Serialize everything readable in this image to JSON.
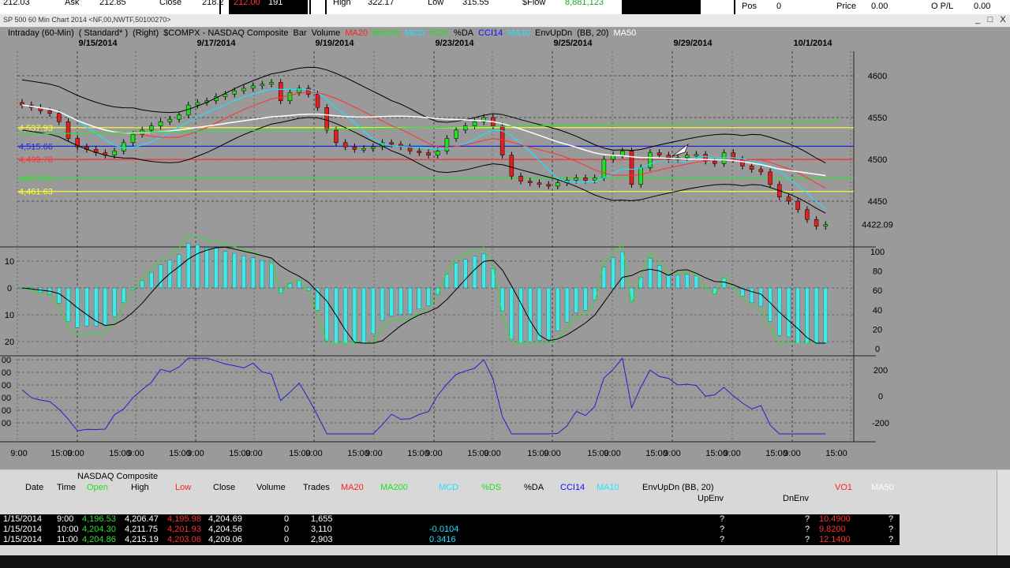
{
  "ticker": {
    "items": [
      {
        "label": "212.03",
        "color": "#000"
      },
      {
        "label": "Ask",
        "color": "#000"
      },
      {
        "label": "212.85",
        "color": "#000"
      },
      {
        "label": "Close",
        "color": "#000"
      },
      {
        "label": "218.2",
        "color": "#000"
      },
      {
        "label": "212.00",
        "color": "#ff2020"
      },
      {
        "label": "191",
        "color": "#fff"
      },
      {
        "label": "High",
        "color": "#000"
      },
      {
        "label": "322.17",
        "color": "#000"
      },
      {
        "label": "Low",
        "color": "#000"
      },
      {
        "label": "315.55",
        "color": "#000"
      },
      {
        "label": "$Flow",
        "color": "#000"
      },
      {
        "label": "8,881,123",
        "color": "#20a020"
      },
      {
        "label": "Pos",
        "color": "#000"
      },
      {
        "label": "0",
        "color": "#000"
      },
      {
        "label": "Price",
        "color": "#000"
      },
      {
        "label": "0.00",
        "color": "#000"
      },
      {
        "label": "O P/L",
        "color": "#000"
      },
      {
        "label": "0.00",
        "color": "#000"
      }
    ]
  },
  "window": {
    "title": "SP 500 60 Min Chart 2014 <NF,00,NWTF,50100270>",
    "minimize": "_",
    "maximize": "□",
    "close": "X"
  },
  "chart_header": [
    {
      "text": "Intraday (60-Min)",
      "color": "#000"
    },
    {
      "text": "( Standard* )",
      "color": "#000"
    },
    {
      "text": "(Right)",
      "color": "#000"
    },
    {
      "text": "$COMPX - NASDAQ Composite",
      "color": "#000"
    },
    {
      "text": "Bar",
      "color": "#000"
    },
    {
      "text": "Volume",
      "color": "#000"
    },
    {
      "text": "MA20",
      "color": "#ff2020"
    },
    {
      "text": "MA200",
      "color": "#20e020"
    },
    {
      "text": "MCD",
      "color": "#20e0ff"
    },
    {
      "text": "%DS",
      "color": "#20e020"
    },
    {
      "text": "%DA",
      "color": "#000"
    },
    {
      "text": "CCI14",
      "color": "#1010ff"
    },
    {
      "text": "MA10",
      "color": "#20e0ff"
    },
    {
      "text": "EnvUpDn",
      "color": "#000"
    },
    {
      "text": "(BB, 20)",
      "color": "#000"
    },
    {
      "text": "MA50",
      "color": "#fff"
    }
  ],
  "date_labels": [
    "9/15/2014",
    "9/17/2014",
    "9/19/2014",
    "9/23/2014",
    "9/25/2014",
    "9/29/2014",
    "10/1/2014"
  ],
  "time_labels": [
    "9:00",
    "15:00",
    "9:00",
    "15:00",
    "9:00",
    "15:00",
    "9:00",
    "15:00",
    "9:00",
    "15:00",
    "9:00",
    "15:00",
    "9:00",
    "15:00",
    "9:00",
    "15:00",
    "9:00",
    "15:00",
    "9:00",
    "15:00",
    "9:00",
    "15:00",
    "9:00",
    "15:00",
    "9:00",
    "15:00",
    "9:00",
    "15:00"
  ],
  "price_axis": [
    "4600",
    "4550",
    "4500",
    "4450"
  ],
  "last_price": "4422.09",
  "levels": [
    {
      "label": "4,537.93",
      "color": "#ffff30"
    },
    {
      "label": "4,515.66",
      "color": "#1e2ad8"
    },
    {
      "label": "4,499.78",
      "color": "#ff3030"
    },
    {
      "label": "4,477.61",
      "color": "#30e030"
    },
    {
      "label": "4,461.63",
      "color": "#ffff30"
    }
  ],
  "macd_axis_left": [
    "10",
    "0",
    "10",
    "20"
  ],
  "macd_axis_right": [
    "100",
    "80",
    "60",
    "40",
    "20",
    "0"
  ],
  "cci_axis_left": [
    "00",
    "00",
    "00",
    "00",
    "00",
    "00"
  ],
  "cci_axis_right": [
    "200",
    "0",
    "-200"
  ],
  "table": {
    "group_title": "NASDAQ Composite",
    "headers": [
      {
        "text": "Date",
        "color": "#000"
      },
      {
        "text": "Time",
        "color": "#000"
      },
      {
        "text": "Open",
        "color": "#20e020"
      },
      {
        "text": "High",
        "color": "#000"
      },
      {
        "text": "Low",
        "color": "#ff2020"
      },
      {
        "text": "Close",
        "color": "#000"
      },
      {
        "text": "Volume",
        "color": "#000"
      },
      {
        "text": "Trades",
        "color": "#000"
      },
      {
        "text": "MA20",
        "color": "#ff2020"
      },
      {
        "text": "MA200",
        "color": "#20e020"
      },
      {
        "text": "MCD",
        "color": "#20e0ff"
      },
      {
        "text": "%DS",
        "color": "#20e020"
      },
      {
        "text": "%DA",
        "color": "#000"
      },
      {
        "text": "CCI14",
        "color": "#1010ff"
      },
      {
        "text": "MA10",
        "color": "#20e0ff"
      },
      {
        "text": "EnvUpDn (BB, 20)",
        "color": "#000"
      },
      {
        "text": "VO1",
        "color": "#ff2020"
      },
      {
        "text": "MA50",
        "color": "#fff"
      }
    ],
    "subheaders": [
      "UpEnv",
      "DnEnv"
    ],
    "rows": [
      {
        "date": "1/15/2014",
        "time": "9:00",
        "open": "4,196.53",
        "high": "4,206.47",
        "low": "4,195.98",
        "close": "4,204.69",
        "volume": "0",
        "trades": "1,655",
        "mcd": "",
        "up": "?",
        "dn": "?",
        "vo": "10.4900",
        "ma50": "?"
      },
      {
        "date": "1/15/2014",
        "time": "10:00",
        "open": "4,204.30",
        "high": "4,211.75",
        "low": "4,201.93",
        "close": "4,204.56",
        "volume": "0",
        "trades": "3,110",
        "mcd": "-0.0104",
        "up": "?",
        "dn": "?",
        "vo": "9.8200",
        "ma50": "?"
      },
      {
        "date": "1/15/2014",
        "time": "11:00",
        "open": "4,204.86",
        "high": "4,215.19",
        "low": "4,203.06",
        "close": "4,209.06",
        "volume": "0",
        "trades": "2,903",
        "mcd": "0.3416",
        "up": "?",
        "dn": "?",
        "vo": "12.1400",
        "ma50": "?"
      }
    ]
  },
  "colors": {
    "chart_bg": "#9a9a9a",
    "up_candle": "#20e020",
    "down_candle": "#e02020",
    "macd_hist": "#40e8e8",
    "cci_line": "#2020d0"
  }
}
